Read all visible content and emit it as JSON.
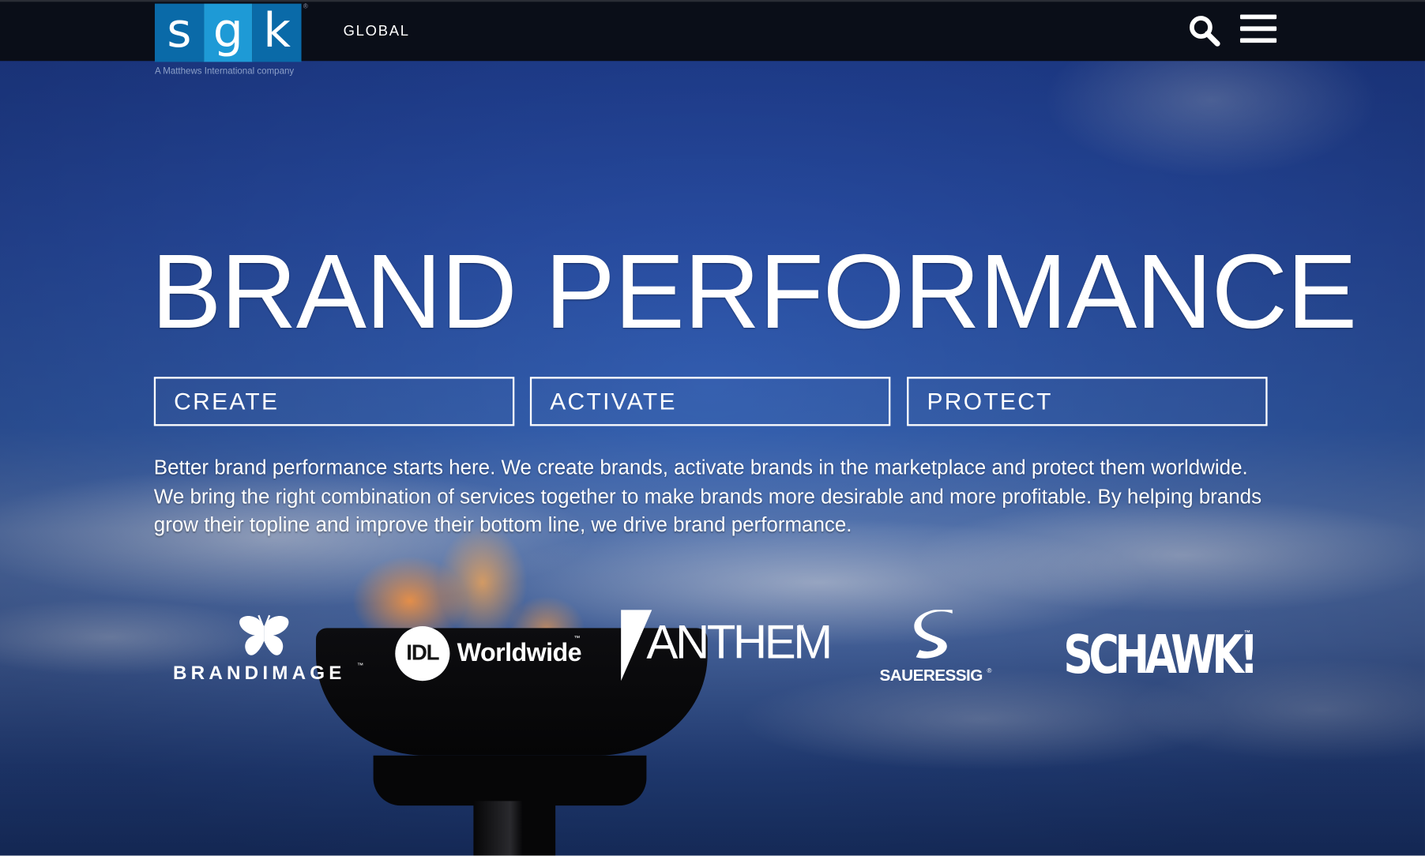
{
  "header": {
    "logo_letters": [
      "s",
      "g",
      "k"
    ],
    "logo_tagline": "A Matthews International company",
    "region_label": "GLOBAL",
    "search_icon": "search-icon",
    "menu_icon": "hamburger-menu-icon"
  },
  "hero": {
    "title": "BRAND PERFORMANCE",
    "pillars": [
      {
        "label": "CREATE"
      },
      {
        "label": "ACTIVATE"
      },
      {
        "label": "PROTECT"
      }
    ],
    "description": "Better brand performance starts here. We create brands, activate brands in the marketplace and protect them worldwide. We bring the right combination of services together to make brands more desirable and more profitable. By helping brands grow their topline and improve their bottom line, we drive brand performance."
  },
  "brands": [
    {
      "name": "BRANDIMAGE",
      "icon": "butterfly-icon"
    },
    {
      "name": "IDL",
      "word": "Worldwide"
    },
    {
      "name": "ANTHEM",
      "icon": "anthem-flag-icon"
    },
    {
      "name": "SAUERESSIG",
      "icon": "saueressig-s-icon"
    },
    {
      "name": "SCHAWK!"
    }
  ],
  "colors": {
    "header_bg": "#0a0e18",
    "logo_blue_dark": "#0a6aa8",
    "logo_blue_light": "#1e9ad6",
    "sky": "#2a50a8",
    "text": "#ffffff"
  }
}
